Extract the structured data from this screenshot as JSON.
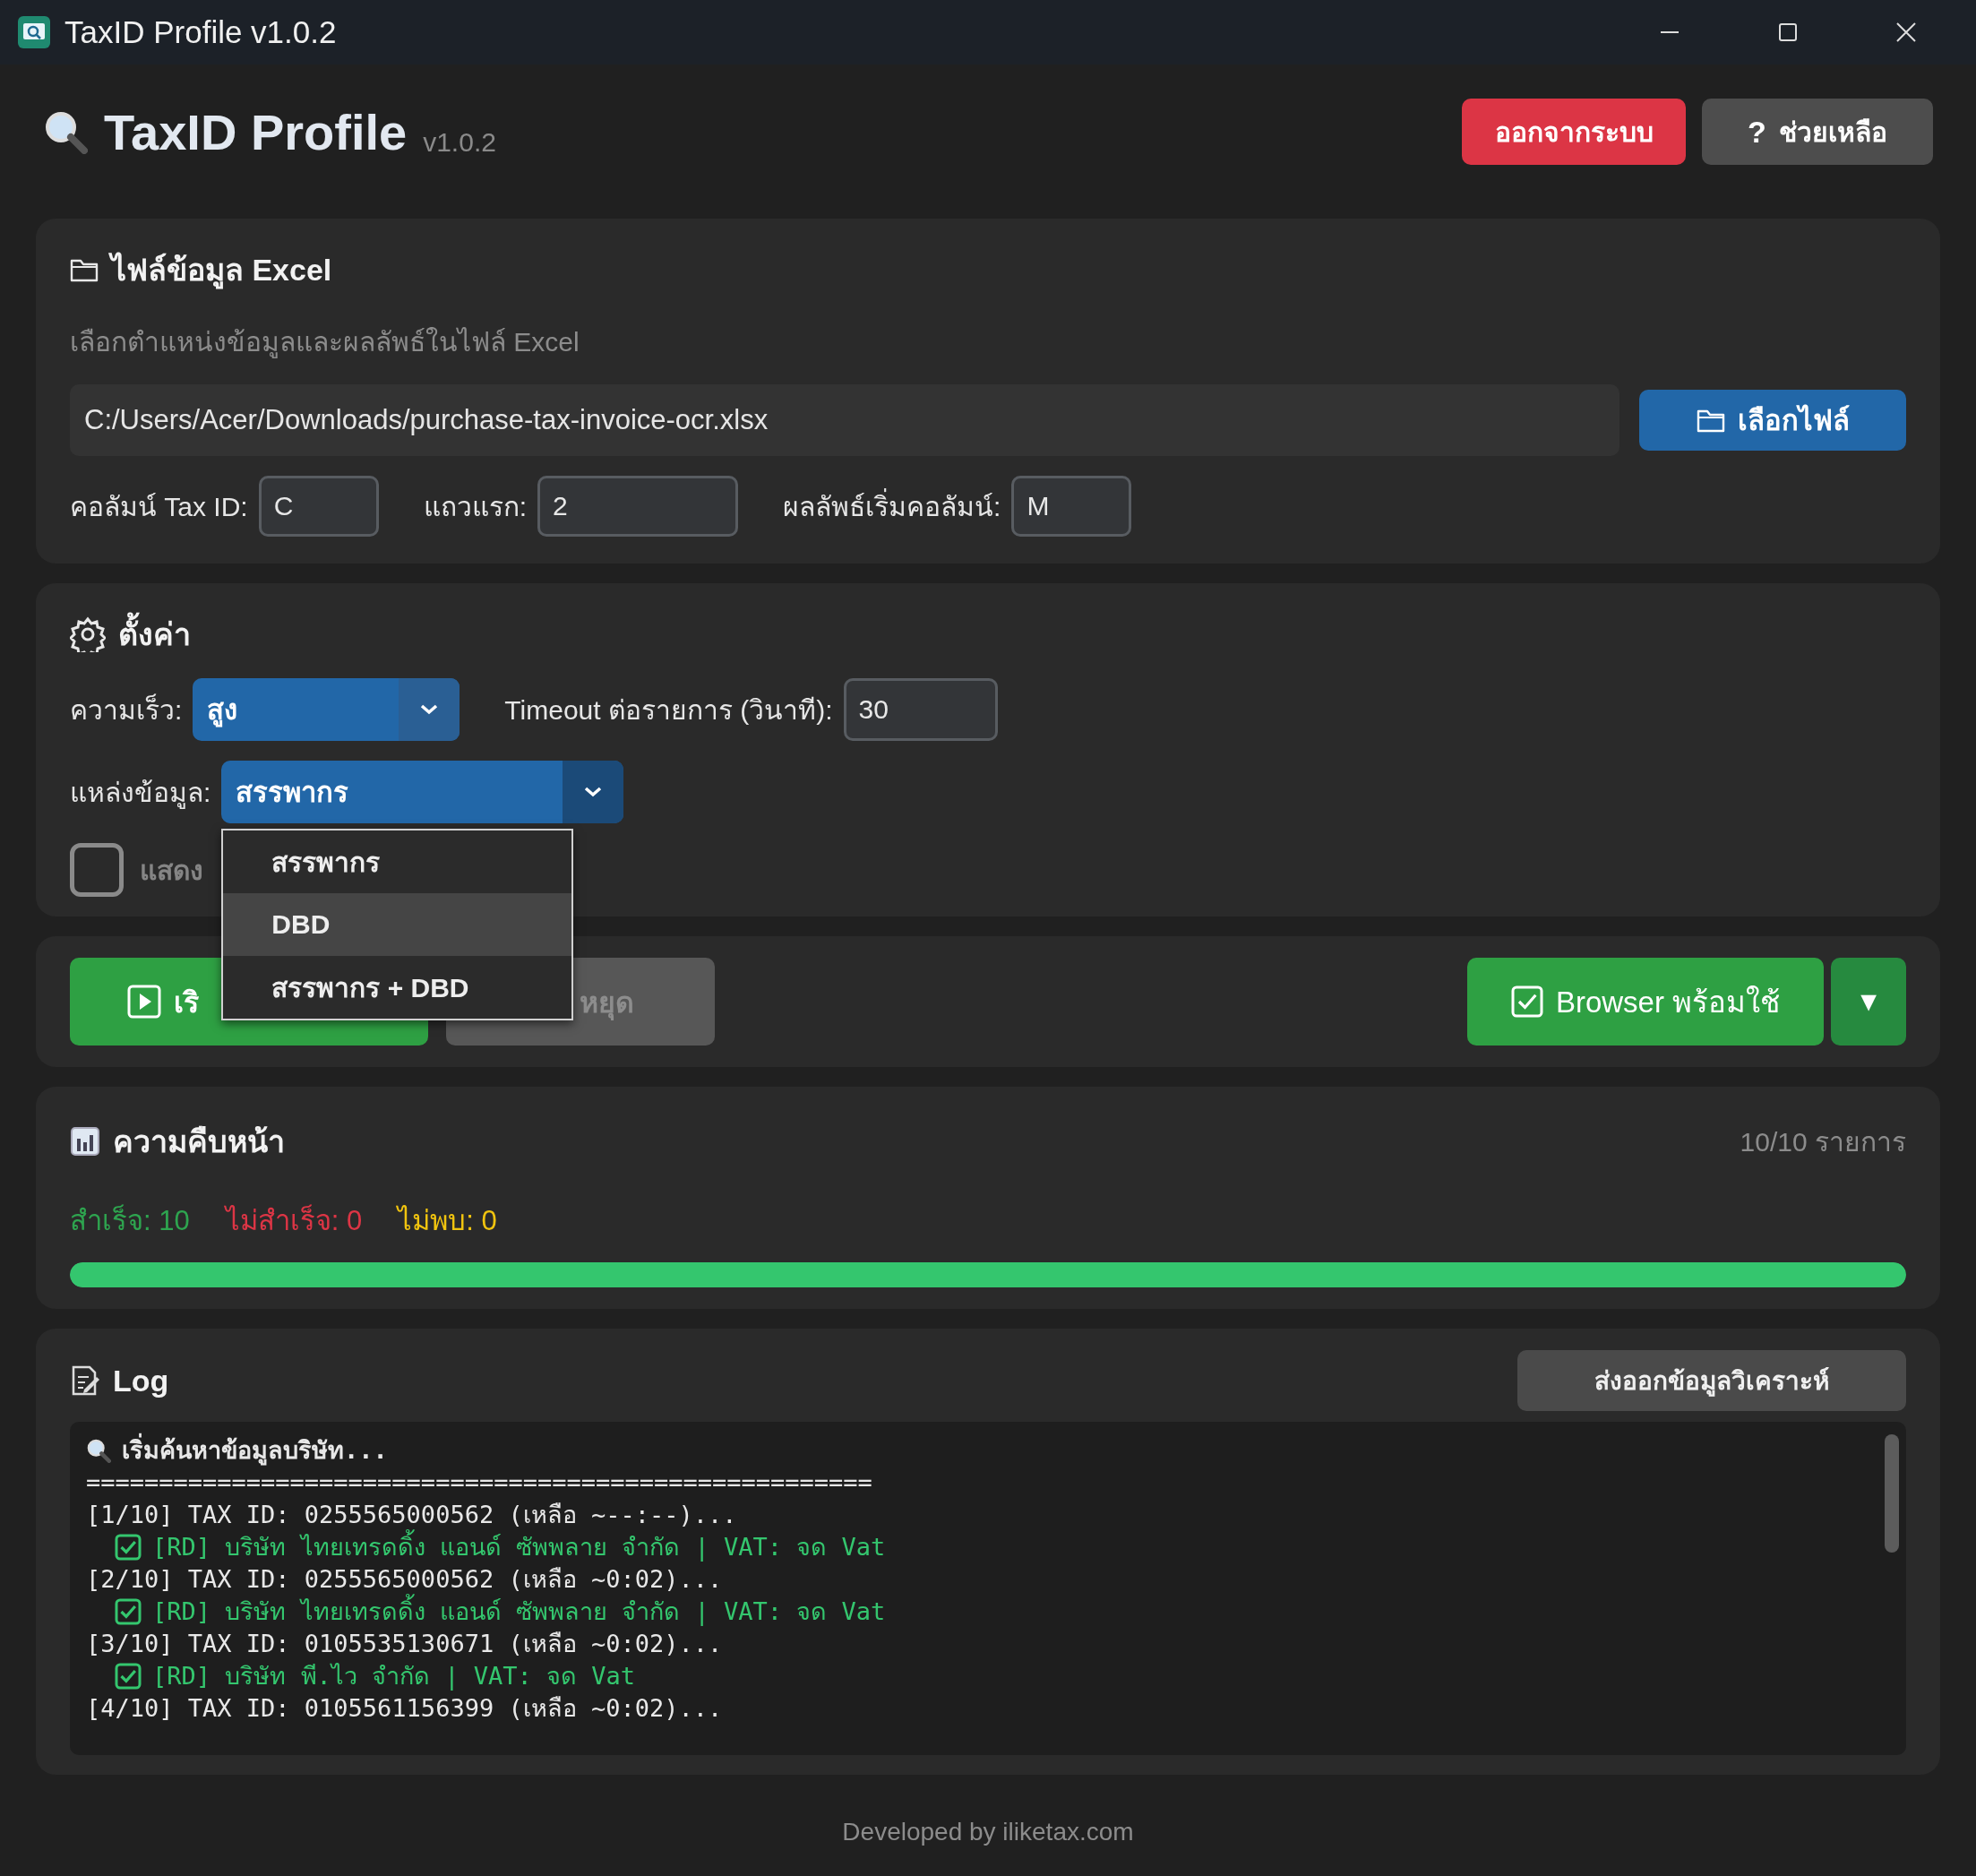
{
  "window": {
    "title": "TaxID Profile v1.0.2"
  },
  "header": {
    "title": "TaxID Profile",
    "version": "v1.0.2",
    "buttons": [
      {
        "kind": "danger",
        "label": "ออกจากระบบ"
      },
      {
        "kind": "secondary",
        "icon": "?",
        "label": "ช่วยเหลือ"
      }
    ]
  },
  "excel": {
    "title": "ไฟล์ข้อมูล Excel",
    "subtitle": "เลือกตำแหน่งข้อมูลและผลลัพธ์ในไฟล์ Excel",
    "file_path": "C:/Users/Acer/Downloads/purchase-tax-invoice-ocr.xlsx",
    "browse_button": "เลือกไฟล์",
    "fields": [
      {
        "label": "คอลัมน์ Tax ID:",
        "value": "C"
      },
      {
        "label": "แถวแรก:",
        "value": "2"
      },
      {
        "label": "ผลลัพธ์เริ่มคอลัมน์:",
        "value": "M"
      }
    ]
  },
  "settings": {
    "title": "ตั้งค่า",
    "speed": {
      "label": "ความเร็ว:",
      "value": "สูง"
    },
    "timeout": {
      "label": "Timeout ต่อรายการ (วินาที):",
      "value": "30"
    },
    "source": {
      "label": "แหล่งข้อมูล:",
      "value": "สรรพากร",
      "expanded": true,
      "options": [
        {
          "label": "สรรพากร",
          "highlighted": false
        },
        {
          "label": "DBD",
          "highlighted": true
        },
        {
          "label": "สรรพากร + DBD",
          "highlighted": false
        }
      ]
    },
    "show_browser": {
      "label": "แสดง",
      "checked": false
    }
  },
  "actions": {
    "start_button": "เริ",
    "stop_button": {
      "label": "หยุด",
      "disabled": true
    },
    "browser_status": "Browser พร้อมใช้",
    "menu_button": "▼"
  },
  "progress": {
    "title": "ความคืบหน้า",
    "count": "10/10 รายการ",
    "stats": [
      {
        "label": "สำเร็จ:",
        "value": "10",
        "color": "#2ea44f"
      },
      {
        "label": "ไม่สำเร็จ:",
        "value": "0",
        "color": "#dc3545"
      },
      {
        "label": "ไม่พบ:",
        "value": "0",
        "color": "#f1c40f"
      }
    ],
    "level": 1.0
  },
  "log": {
    "title": "Log",
    "export_button": "ส่งออกข้อมูลวิเคราะห์",
    "lines": [
      {
        "kind": "info",
        "text": "เริ่มค้นหาข้อมูลบริษัท..."
      },
      {
        "kind": "plain",
        "text": "======================================================"
      },
      {
        "kind": "plain",
        "text": "[1/10] TAX ID: 0255565000562 (เหลือ ~--:--)..."
      },
      {
        "kind": "success",
        "text": "[RD] บริษัท ไทยเทรดดิ้ง แอนด์ ซัพพลาย จำกัด | VAT: จด Vat"
      },
      {
        "kind": "plain",
        "text": "[2/10] TAX ID: 0255565000562 (เหลือ ~0:02)..."
      },
      {
        "kind": "success",
        "text": "[RD] บริษัท ไทยเทรดดิ้ง แอนด์ ซัพพลาย จำกัด | VAT: จด Vat"
      },
      {
        "kind": "plain",
        "text": "[3/10] TAX ID: 0105535130671 (เหลือ ~0:02)..."
      },
      {
        "kind": "success",
        "text": "[RD] บริษัท พี.ไว จำกัด | VAT: จด Vat"
      },
      {
        "kind": "plain",
        "text": "[4/10] TAX ID: 0105561156399 (เหลือ ~0:02)..."
      }
    ]
  },
  "footer": "Developed by iliketax.com"
}
